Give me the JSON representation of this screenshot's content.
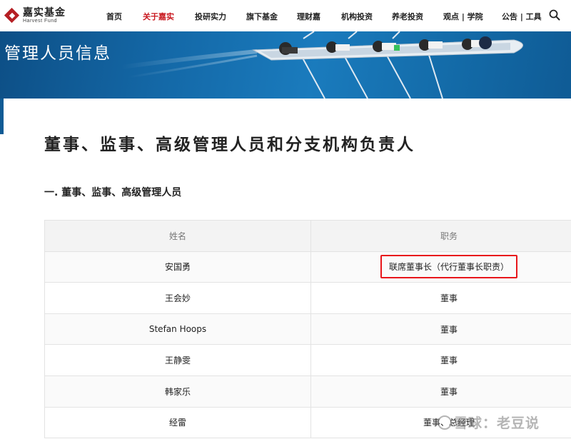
{
  "header": {
    "logo": {
      "name_cn": "嘉实基金",
      "name_en": "Harvest Fund",
      "icon": "harvest-diamond-logo"
    },
    "nav": [
      {
        "label": "首页",
        "active": false
      },
      {
        "label": "关于嘉实",
        "active": true
      },
      {
        "label": "投研实力",
        "active": false
      },
      {
        "label": "旗下基金",
        "active": false
      },
      {
        "label": "理财嘉",
        "active": false
      },
      {
        "label": "机构投资",
        "active": false
      },
      {
        "label": "养老投资",
        "active": false
      },
      {
        "label": "观点 | 学院",
        "active": false
      },
      {
        "label": "公告 | 工具",
        "active": false
      }
    ],
    "search_icon": "search-icon"
  },
  "banner": {
    "title": "管理人员信息",
    "image": "rowing-boat-aerial"
  },
  "main": {
    "title": "董事、监事、高级管理人员和分支机构负责人",
    "section_title": "一. 董事、监事、高级管理人员",
    "table": {
      "headers": [
        "姓名",
        "职务"
      ],
      "rows": [
        {
          "name": "安国勇",
          "position": "联席董事长（代行董事长职责）",
          "highlighted": true
        },
        {
          "name": "王会妙",
          "position": "董事",
          "highlighted": false
        },
        {
          "name": "Stefan Hoops",
          "position": "董事",
          "highlighted": false
        },
        {
          "name": "王静雯",
          "position": "董事",
          "highlighted": false
        },
        {
          "name": "韩家乐",
          "position": "董事",
          "highlighted": false
        },
        {
          "name": "经雷",
          "position": "董事、总经理",
          "highlighted": false
        }
      ]
    }
  },
  "watermark": "雪球：老豆说",
  "colors": {
    "brand_red": "#c8161d",
    "banner_blue": "#1469a8",
    "highlight_border": "#e8161b"
  }
}
